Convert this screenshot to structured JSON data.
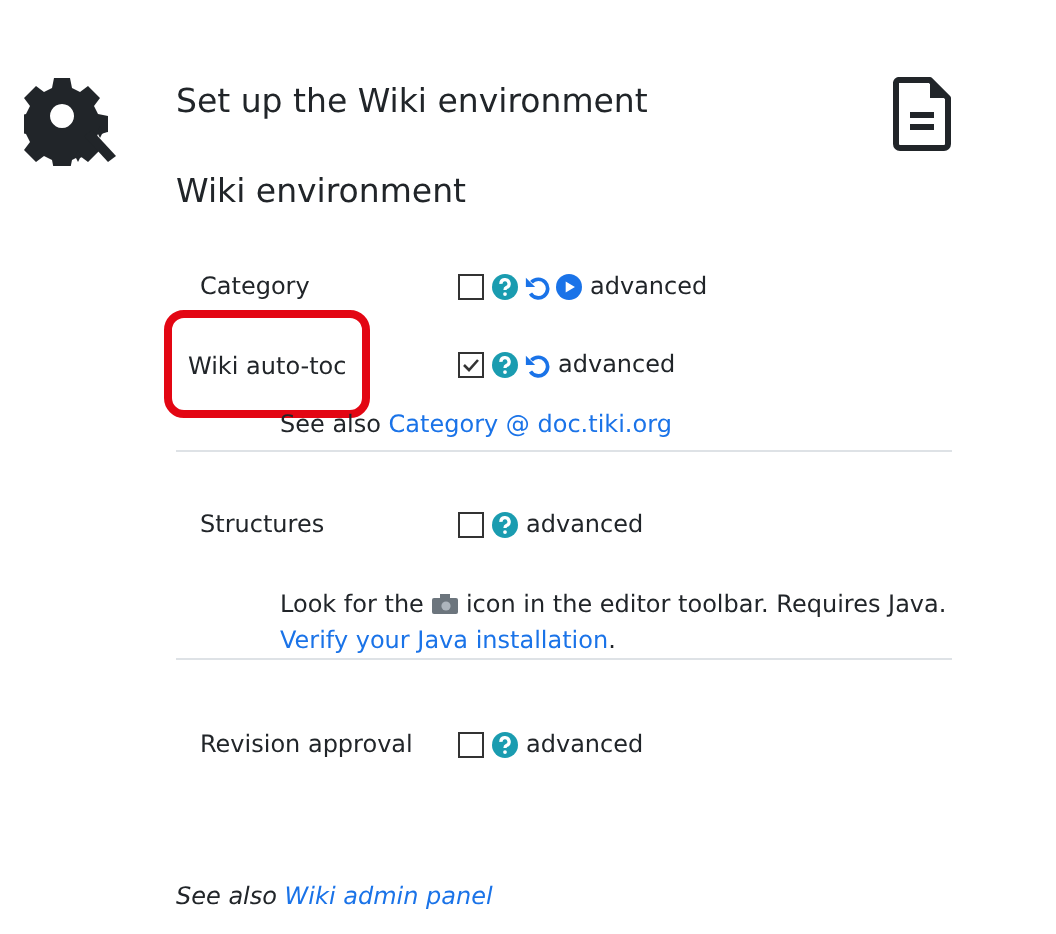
{
  "header": {
    "title": "Set up the Wiki environment"
  },
  "section": {
    "title": "Wiki environment"
  },
  "preferences": [
    {
      "label": "Category",
      "highlighted": false,
      "checked": false,
      "help": true,
      "reset": true,
      "more": true,
      "tag": "advanced"
    },
    {
      "label": "Wiki auto-toc",
      "highlighted": true,
      "checked": true,
      "help": true,
      "reset": true,
      "more": false,
      "tag": "advanced",
      "note": {
        "kind": "see_also",
        "text": "See also",
        "link": "Category @ doc.tiki.org"
      }
    },
    {
      "label": "Structures",
      "highlighted": false,
      "checked": false,
      "help": true,
      "reset": false,
      "more": false,
      "tag": "advanced",
      "note": {
        "kind": "toolbar_hint",
        "before": "Look for the",
        "after": "icon in the editor toolbar. Requires Java.",
        "link": "Verify your Java installation",
        "tail": "."
      }
    },
    {
      "label": "Revision approval",
      "highlighted": false,
      "checked": false,
      "help": true,
      "reset": false,
      "more": false,
      "tag": "advanced"
    }
  ],
  "footer": {
    "text": "See also",
    "link": "Wiki admin panel"
  }
}
